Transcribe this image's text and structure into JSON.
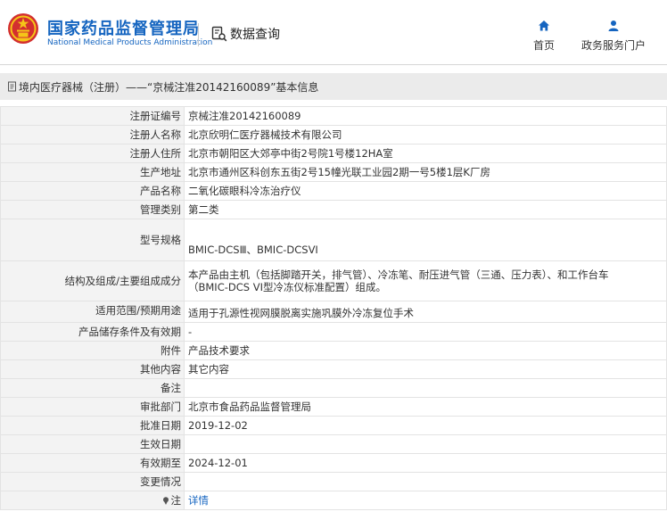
{
  "header": {
    "org_name_cn": "国家药品监督管理局",
    "org_name_en": "National Medical Products Administration",
    "data_query": "数据查询",
    "nav": [
      {
        "label": "首页",
        "icon": "home-icon"
      },
      {
        "label": "政务服务门户",
        "icon": "user-icon"
      }
    ]
  },
  "breadcrumb": {
    "text": "境内医疗器械（注册）——“京械注准20142160089”基本信息"
  },
  "rows": [
    {
      "label": "注册证编号",
      "value": "京械注准20142160089"
    },
    {
      "label": "注册人名称",
      "value": "北京欣明仁医疗器械技术有限公司"
    },
    {
      "label": "注册人住所",
      "value": "北京市朝阳区大郊亭中街2号院1号楼12HA室"
    },
    {
      "label": "生产地址",
      "value": "北京市通州区科创东五街2号15幢光联工业园2期一号5楼1层K厂房"
    },
    {
      "label": "产品名称",
      "value": "二氧化碳眼科冷冻治疗仪"
    },
    {
      "label": "管理类别",
      "value": "第二类"
    },
    {
      "label": "型号规格",
      "value": "BMIC-DCSⅢ、BMIC-DCSVI"
    },
    {
      "label": "结构及组成/主要组成成分",
      "value_line1": "本产品由主机（包括脚踏开关，排气管）、冷冻笔、耐压进气管（三通、压力表）、和工作台车",
      "value_line2": "（BMIC-DCS VI型冷冻仪标准配置）组成。"
    },
    {
      "label": "适用范围/预期用途",
      "value": "适用于孔源性视网膜脱离实施巩膜外冷冻复位手术"
    },
    {
      "label": "产品储存条件及有效期",
      "value": "-"
    },
    {
      "label": "附件",
      "value": "产品技术要求"
    },
    {
      "label": "其他内容",
      "value": "其它内容"
    },
    {
      "label": "备注",
      "value": ""
    },
    {
      "label": "审批部门",
      "value": "北京市食品药品监督管理局"
    },
    {
      "label": "批准日期",
      "value": "2019-12-02"
    },
    {
      "label": "生效日期",
      "value": ""
    },
    {
      "label": "有效期至",
      "value": "2024-12-01"
    },
    {
      "label": "变更情况",
      "value": ""
    },
    {
      "label": "注",
      "value": "详情",
      "icon": "pin-icon"
    }
  ],
  "colors": {
    "brand_blue": "#1565c0",
    "emblem_red": "#d32f2f",
    "emblem_gold": "#f5c518",
    "label_bg": "#f3f3f3",
    "breadcrumb_bg": "#ebebeb"
  }
}
